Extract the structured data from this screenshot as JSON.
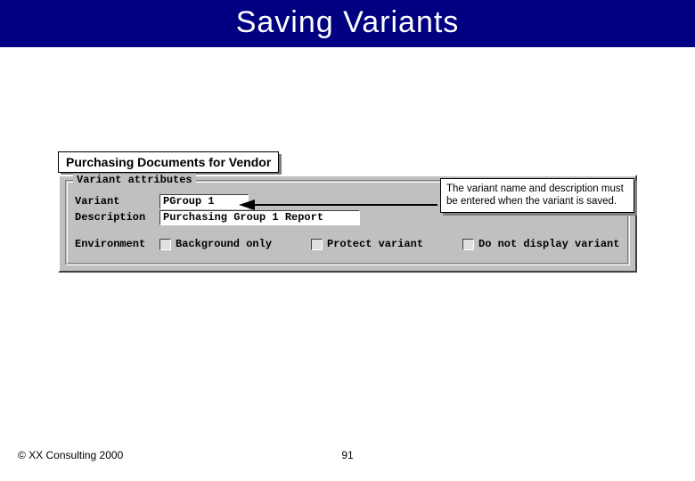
{
  "title": "Saving Variants",
  "panel": {
    "heading": "Purchasing Documents for Vendor",
    "group_legend": "Variant attributes",
    "rows": {
      "variant_label": "Variant",
      "variant_value": "PGroup 1",
      "description_label": "Description",
      "description_value": "Purchasing Group 1 Report",
      "environment_label": "Environment",
      "opt_background": "Background only",
      "opt_protect": "Protect variant",
      "opt_nodisplay": "Do not display variant"
    }
  },
  "callout": "The variant name and description must be entered when the variant is saved.",
  "footer": {
    "copyright": "© XX Consulting 2000",
    "page": "91"
  }
}
